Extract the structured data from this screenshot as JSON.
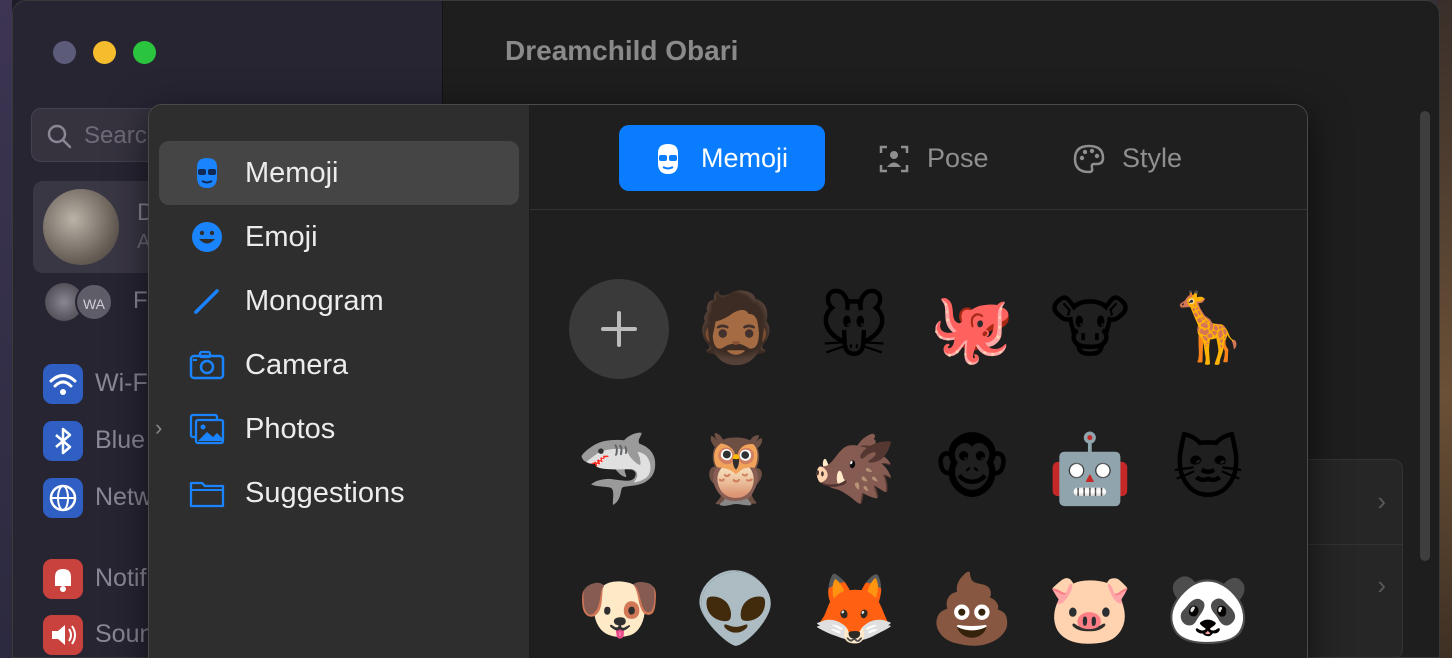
{
  "window": {
    "title": "Dreamchild Obari",
    "search_placeholder": "Search",
    "profile": {
      "name": "D",
      "subtitle": "A"
    },
    "family": {
      "initials": "WA",
      "label": "F"
    },
    "sidebar_items": [
      {
        "label": "Wi-F",
        "icon": "wifi-icon",
        "color": "#2f6fd6"
      },
      {
        "label": "Blue",
        "icon": "bluetooth-icon",
        "color": "#2f6fd6"
      },
      {
        "label": "Netw",
        "icon": "globe-icon",
        "color": "#2f6fd6"
      },
      {
        "label": "Notif",
        "icon": "bell-icon",
        "color": "#e0443e"
      },
      {
        "label": "Soun",
        "icon": "speaker-icon",
        "color": "#e0443e"
      }
    ]
  },
  "picker": {
    "sidebar": [
      {
        "label": "Memoji",
        "icon": "memoji-icon",
        "selected": true
      },
      {
        "label": "Emoji",
        "icon": "smiley-icon",
        "selected": false
      },
      {
        "label": "Monogram",
        "icon": "pencil-icon",
        "selected": false
      },
      {
        "label": "Camera",
        "icon": "camera-icon",
        "selected": false
      },
      {
        "label": "Photos",
        "icon": "photos-icon",
        "selected": false,
        "expandable": true
      },
      {
        "label": "Suggestions",
        "icon": "folder-icon",
        "selected": false
      }
    ],
    "segments": [
      {
        "label": "Memoji",
        "icon": "memoji-icon",
        "active": true
      },
      {
        "label": "Pose",
        "icon": "pose-icon",
        "active": false
      },
      {
        "label": "Style",
        "icon": "palette-icon",
        "active": false
      }
    ],
    "accent_color": "#0a7cff",
    "grid": [
      [
        {
          "name": "add-memoji-button",
          "glyph": ""
        },
        {
          "name": "memoji-person",
          "glyph": "🧔🏾"
        },
        {
          "name": "memoji-mouse",
          "glyph": "🐭"
        },
        {
          "name": "memoji-octopus",
          "glyph": "🐙"
        },
        {
          "name": "memoji-cow",
          "glyph": "🐮"
        },
        {
          "name": "memoji-giraffe",
          "glyph": "🦒"
        }
      ],
      [
        {
          "name": "memoji-shark",
          "glyph": "🦈"
        },
        {
          "name": "memoji-owl",
          "glyph": "🦉"
        },
        {
          "name": "memoji-boar",
          "glyph": "🐗"
        },
        {
          "name": "memoji-monkey",
          "glyph": "🐵"
        },
        {
          "name": "memoji-robot",
          "glyph": "🤖"
        },
        {
          "name": "memoji-cat",
          "glyph": "🐱"
        }
      ],
      [
        {
          "name": "memoji-dog",
          "glyph": "🐶"
        },
        {
          "name": "memoji-alien",
          "glyph": "👽"
        },
        {
          "name": "memoji-fox",
          "glyph": "🦊"
        },
        {
          "name": "memoji-poop",
          "glyph": "💩"
        },
        {
          "name": "memoji-pig",
          "glyph": "🐷"
        },
        {
          "name": "memoji-panda",
          "glyph": "🐼"
        }
      ]
    ]
  }
}
